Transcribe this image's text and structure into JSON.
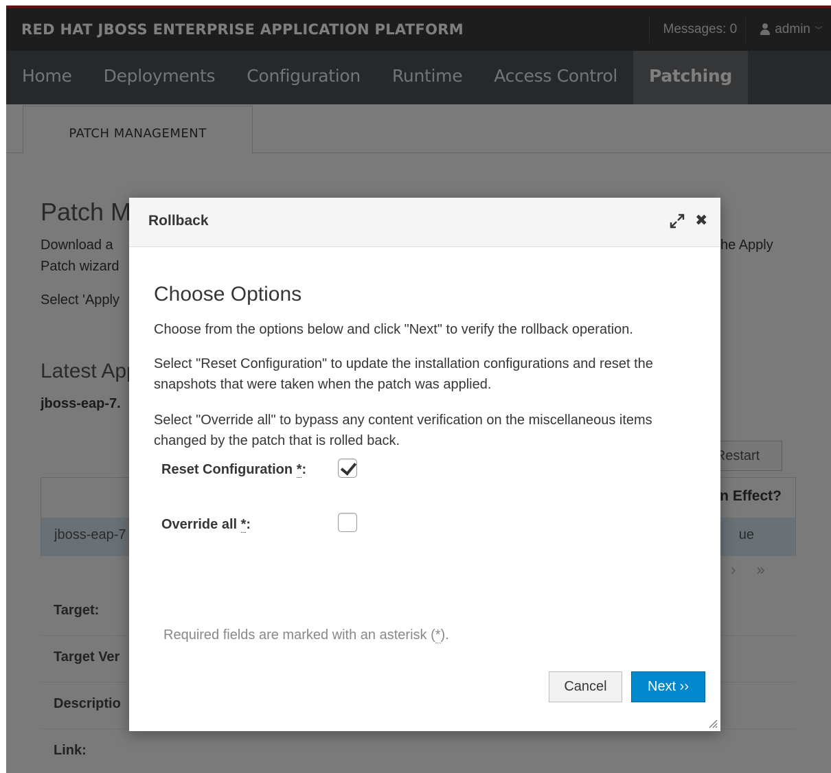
{
  "topbar": {
    "brand": "RED HAT JBOSS ENTERPRISE APPLICATION PLATFORM",
    "messages": "Messages: 0",
    "user": "admin"
  },
  "nav": {
    "items": [
      "Home",
      "Deployments",
      "Configuration",
      "Runtime",
      "Access Control",
      "Patching"
    ],
    "active": "Patching"
  },
  "tab": {
    "label": "PATCH MANAGEMENT"
  },
  "background": {
    "title": "Patch M",
    "desc_line1": "Download a",
    "desc_line2": "Patch wizard",
    "desc_right": "he Apply",
    "select_text": "Select 'Apply",
    "latest": "Latest App",
    "latest_value": "jboss-eap-7.",
    "restart_button": "Restart",
    "table_header": "n Effect?",
    "row_left": "jboss-eap-7",
    "row_right": "ue",
    "pager": "› »",
    "rows": [
      "Target:",
      "Target Ver",
      "Descriptio",
      "Link:"
    ]
  },
  "modal": {
    "title": "Rollback",
    "heading": "Choose Options",
    "p1": "Choose from the options below and click \"Next\" to verify the rollback operation.",
    "p2": "Select \"Reset Configuration\" to update the installation configurations and reset the snapshots that were taken when the patch was applied.",
    "p3": "Select \"Override all\" to bypass any content verification on the miscellaneous items changed by the patch that is rolled back.",
    "reset_label": "Reset Configuration",
    "reset_checked": true,
    "override_label": "Override all",
    "override_checked": false,
    "asterisk": "*",
    "colon": ":",
    "note_prefix": "Required fields are marked with an asterisk (",
    "note_suffix": ").",
    "cancel": "Cancel",
    "next": "Next ››"
  }
}
